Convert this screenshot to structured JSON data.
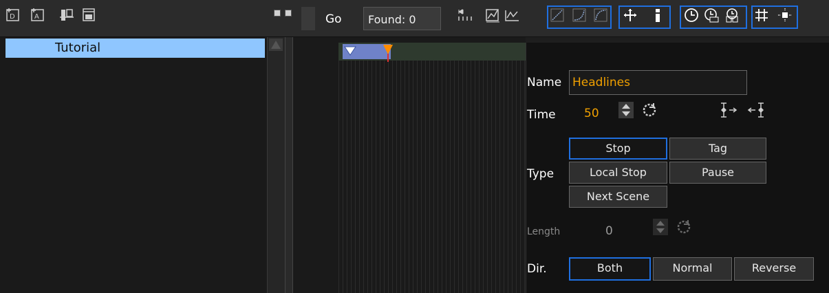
{
  "toolbar": {
    "go_label": "Go",
    "found_label": "Found: 0",
    "icons": [
      "add-director-icon",
      "add-actor-icon",
      "add-stop-point-icon",
      "add-tag-icon",
      "first-frame-icon",
      "graph-icon",
      "curve-icon",
      "ease-linear-icon",
      "ease-in-icon",
      "ease-out-icon",
      "move-icon",
      "info-icon",
      "clock-icon",
      "clock-edit-icon",
      "clock-copy-icon",
      "grid-icon",
      "snap-icon"
    ],
    "accent": "#1f6fe0"
  },
  "tree": {
    "items": [
      {
        "label": "Tutorial",
        "selected": true
      }
    ],
    "selected_color": "#8fc6ff"
  },
  "editor": {
    "name_label": "Name",
    "name_value": "Headlines",
    "time_label": "Time",
    "time_value": "50",
    "type_label": "Type",
    "type_buttons": {
      "stop": "Stop",
      "tag": "Tag",
      "local_stop": "Local Stop",
      "pause": "Pause",
      "next_scene": "Next Scene"
    },
    "type_selected": "Stop",
    "length_label": "Length",
    "length_value": "0",
    "dir_label": "Dir.",
    "dir_buttons": {
      "both": "Both",
      "normal": "Normal",
      "reverse": "Reverse"
    },
    "dir_selected": "Both",
    "value_color": "#f0a000"
  }
}
